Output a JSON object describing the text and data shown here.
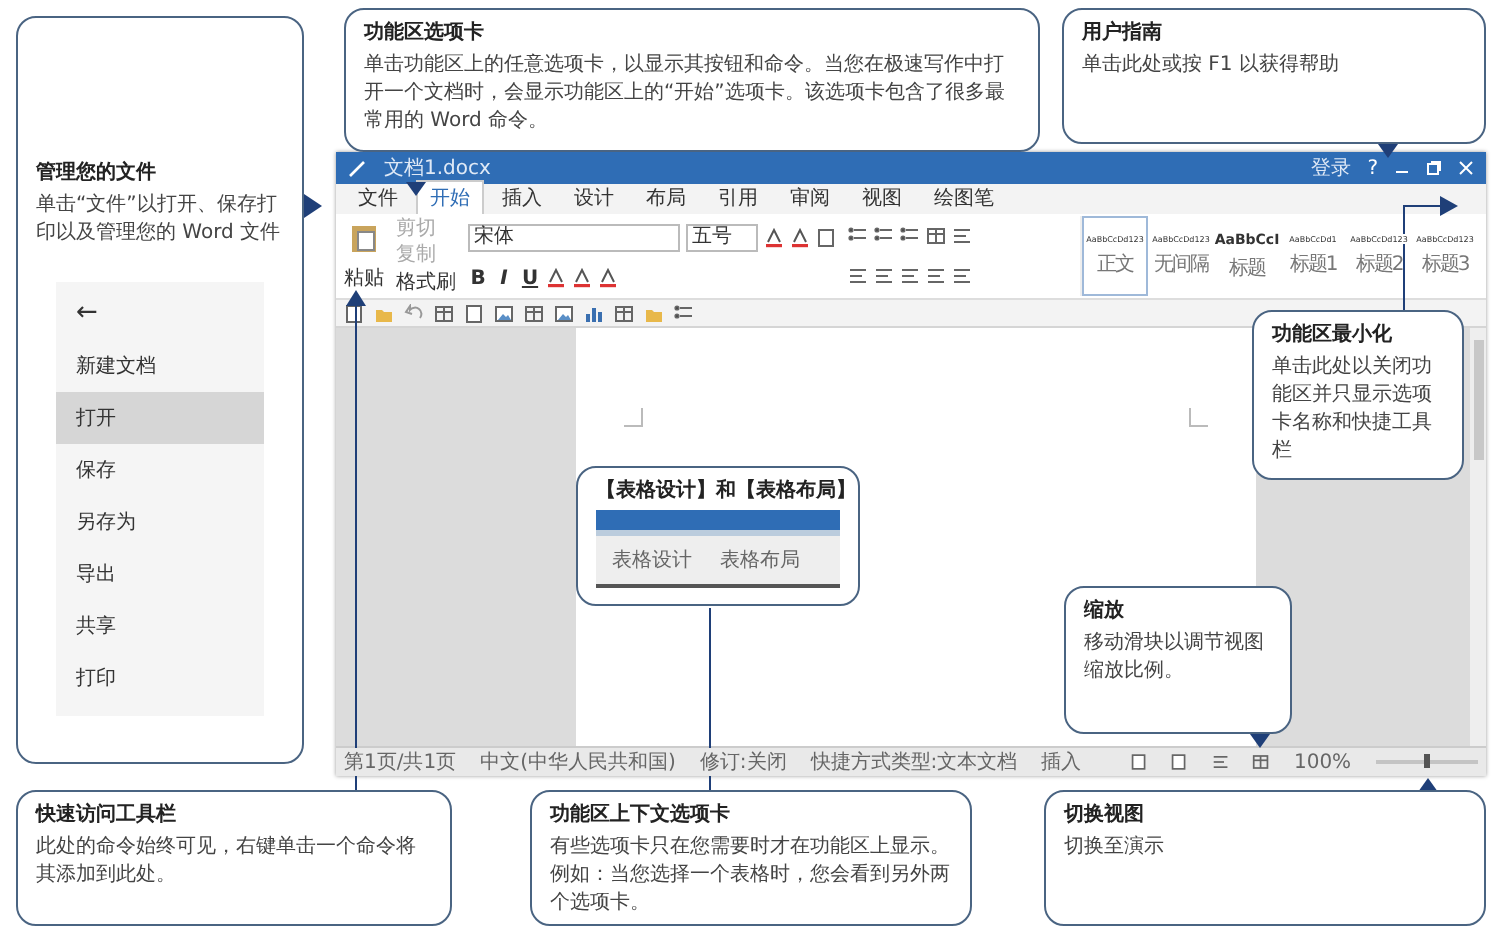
{
  "window": {
    "title": "文档1.docx",
    "sign_in": "登录",
    "help": "?"
  },
  "menu_tabs": [
    {
      "label": "文件",
      "selected": false
    },
    {
      "label": "开始",
      "selected": true
    },
    {
      "label": "插入",
      "selected": false
    },
    {
      "label": "设计",
      "selected": false
    },
    {
      "label": "布局",
      "selected": false
    },
    {
      "label": "引用",
      "selected": false
    },
    {
      "label": "审阅",
      "selected": false
    },
    {
      "label": "视图",
      "selected": false
    },
    {
      "label": "绘图笔",
      "selected": false
    }
  ],
  "ribbon": {
    "paste": "粘贴",
    "clipboard": [
      {
        "label": "剪切",
        "disabled": true
      },
      {
        "label": "复制",
        "disabled": true
      },
      {
        "label": "格式刷",
        "disabled": false
      }
    ],
    "font": "宋体",
    "size": "五号",
    "format_buttons": [
      "B",
      "I",
      "U"
    ],
    "styles": [
      {
        "preview": "AaBbCcDd123",
        "label": "正文",
        "selected": true
      },
      {
        "preview": "AaBbCcDd123",
        "label": "无间隔",
        "selected": false
      },
      {
        "preview": "AaBbCcI",
        "label": "标题",
        "selected": false
      },
      {
        "preview": "AaBbCcDd1",
        "label": "标题1",
        "selected": false
      },
      {
        "preview": "AaBbCcDd123",
        "label": "标题2",
        "selected": false
      },
      {
        "preview": "AaBbCcDd123",
        "label": "标题3",
        "selected": false
      }
    ]
  },
  "file_menu": {
    "back": "←",
    "items": [
      {
        "label": "新建文档",
        "selected": false
      },
      {
        "label": "打开",
        "selected": true
      },
      {
        "label": "保存",
        "selected": false
      },
      {
        "label": "另存为",
        "selected": false
      },
      {
        "label": "导出",
        "selected": false
      },
      {
        "label": "共享",
        "selected": false
      },
      {
        "label": "打印",
        "selected": false
      }
    ]
  },
  "table_demo": {
    "tabs": [
      "表格设计",
      "表格布局"
    ]
  },
  "status_bar": {
    "items": [
      "第1页/共1页",
      "中文(中华人民共和国)",
      "修订:关闭",
      "快捷方式类型:文本文档",
      "插入"
    ],
    "zoom": "100%"
  },
  "callouts": [
    {
      "title": "管理您的文件",
      "text": "单击“文件”以打开、保存打印以及管理您的 Word 文件"
    },
    {
      "title": "功能区选项卡",
      "text": "单击功能区上的任意选项卡，以显示其按钮和命令。当您在极速写作中打开一个文档时，会显示功能区上的“开始”选项卡。该选项卡包含了很多最常用的 Word 命令。"
    },
    {
      "title": "用户指南",
      "text": "单击此处或按 F1 以获得帮助"
    },
    {
      "title": "功能区最小化",
      "text": "单击此处以关闭功能区并只显示选项卡名称和快捷工具栏"
    },
    {
      "title": "【表格设计】和【表格布局】"
    },
    {
      "title": "缩放",
      "text": "移动滑块以调节视图缩放比例。"
    },
    {
      "title": "快速访问工具栏",
      "text": "此处的命令始终可见，右键单击一个命令将其添加到此处。"
    },
    {
      "title": "功能区上下文选项卡",
      "text": "有些选项卡只在您需要时才在功能区上显示。例如：当您选择一个表格时，您会看到另外两个选项卡。"
    },
    {
      "title": "切换视图",
      "text": "切换至演示"
    }
  ]
}
